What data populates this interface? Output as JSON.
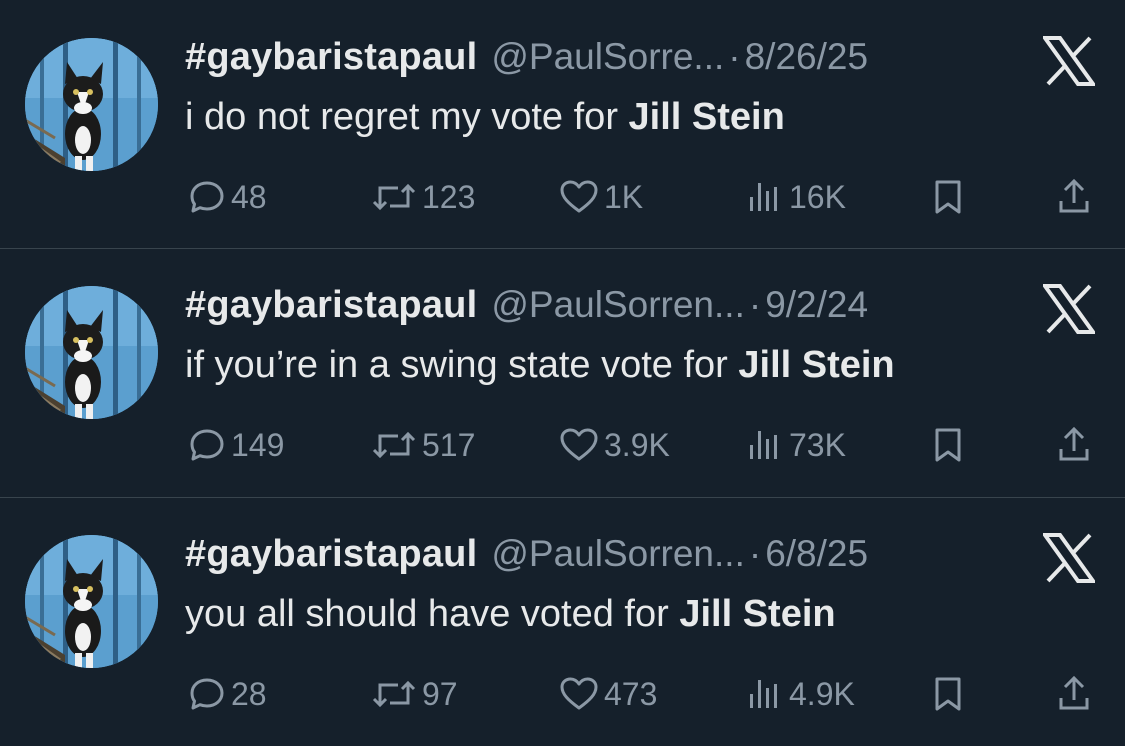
{
  "tweets": [
    {
      "display_name": "#gaybaristapaul",
      "handle": "@PaulSorre...",
      "separator": "·",
      "date": "8/26/25",
      "text_plain": "i do not regret my vote for ",
      "text_bold": "Jill Stein",
      "replies": "48",
      "retweets": "123",
      "likes": "1K",
      "views": "16K"
    },
    {
      "display_name": "#gaybaristapaul",
      "handle": "@PaulSorren...",
      "separator": "·",
      "date": "9/2/24",
      "text_plain": "if you’re in a swing state vote for ",
      "text_bold": "Jill Stein",
      "replies": "149",
      "retweets": "517",
      "likes": "3.9K",
      "views": "73K"
    },
    {
      "display_name": "#gaybaristapaul",
      "handle": "@PaulSorren...",
      "separator": "·",
      "date": "6/8/25",
      "text_plain": "you all should have voted for ",
      "text_bold": "Jill Stein",
      "replies": "28",
      "retweets": "97",
      "likes": "473",
      "views": "4.9K"
    }
  ],
  "icons": {
    "logo": "x-logo-icon",
    "reply": "reply-icon",
    "retweet": "retweet-icon",
    "like": "heart-icon",
    "views": "views-icon",
    "bookmark": "bookmark-icon",
    "share": "share-icon"
  },
  "colors": {
    "background": "#15202b",
    "text": "#e7e9ea",
    "secondary": "#8b98a5",
    "divider": "#38444d"
  }
}
